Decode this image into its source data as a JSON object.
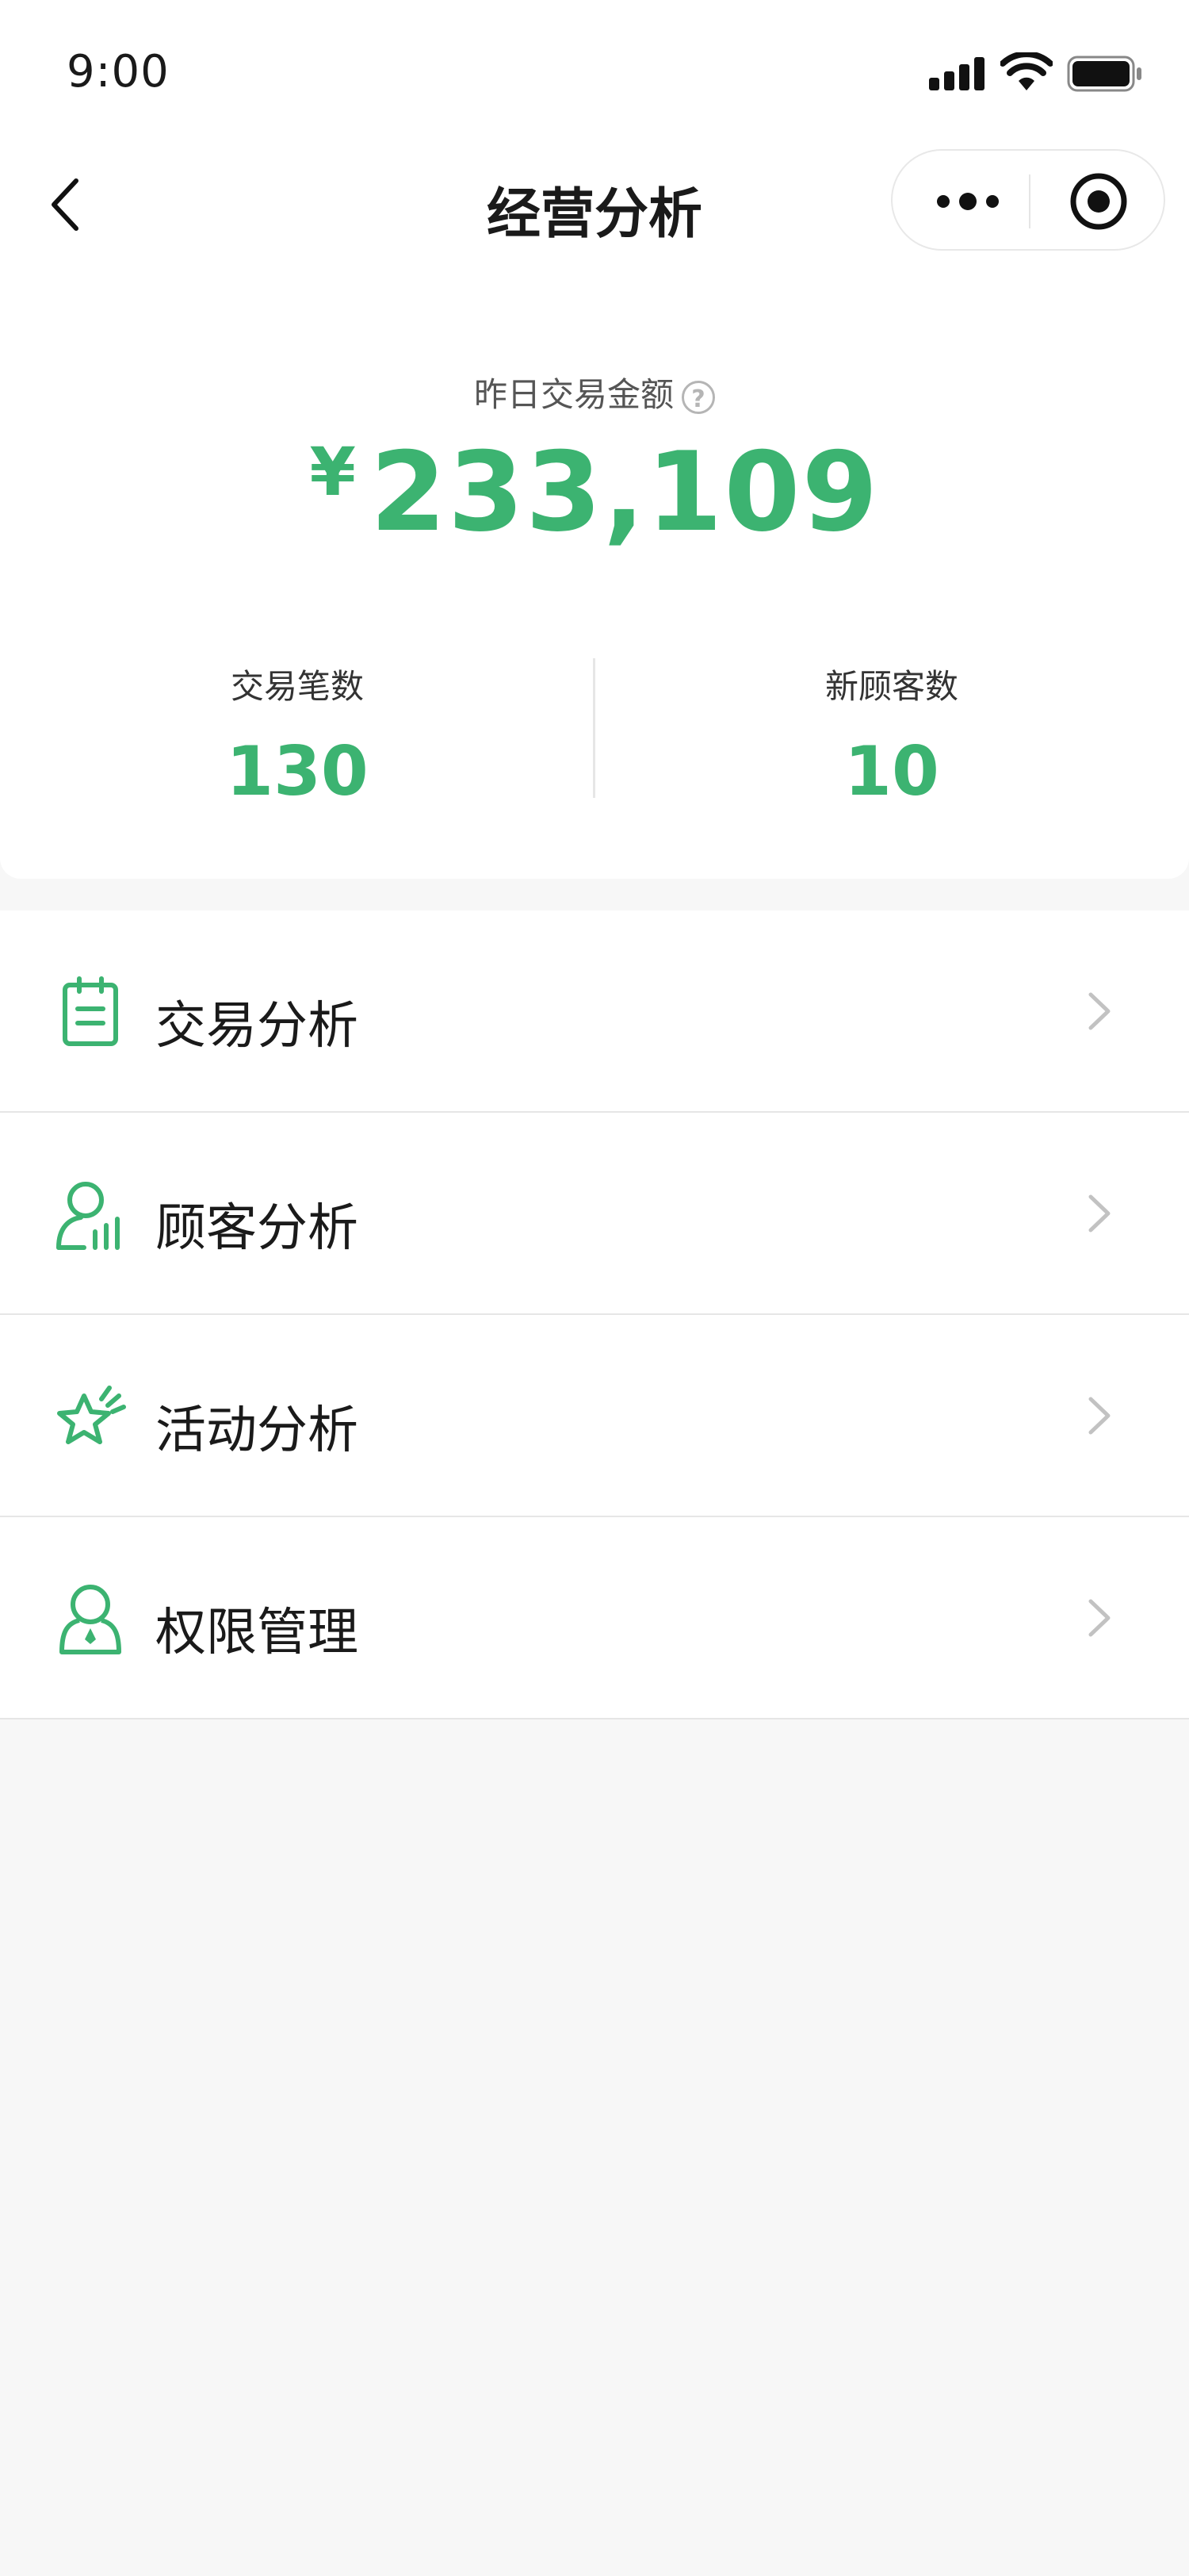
{
  "status_bar": {
    "time": "9:00"
  },
  "nav": {
    "title": "经营分析"
  },
  "summary": {
    "label": "昨日交易金额",
    "help": "?",
    "currency": "¥",
    "amount": "233,109",
    "stats": [
      {
        "label": "交易笔数",
        "value": "130"
      },
      {
        "label": "新顾客数",
        "value": "10"
      }
    ]
  },
  "menu": [
    {
      "label": "交易分析",
      "icon": "clipboard-icon"
    },
    {
      "label": "顾客分析",
      "icon": "customer-stats-icon"
    },
    {
      "label": "活动分析",
      "icon": "star-icon"
    },
    {
      "label": "权限管理",
      "icon": "user-lock-icon"
    }
  ],
  "colors": {
    "accent": "#3cb371",
    "background": "#f7f7f7",
    "card": "#ffffff"
  }
}
